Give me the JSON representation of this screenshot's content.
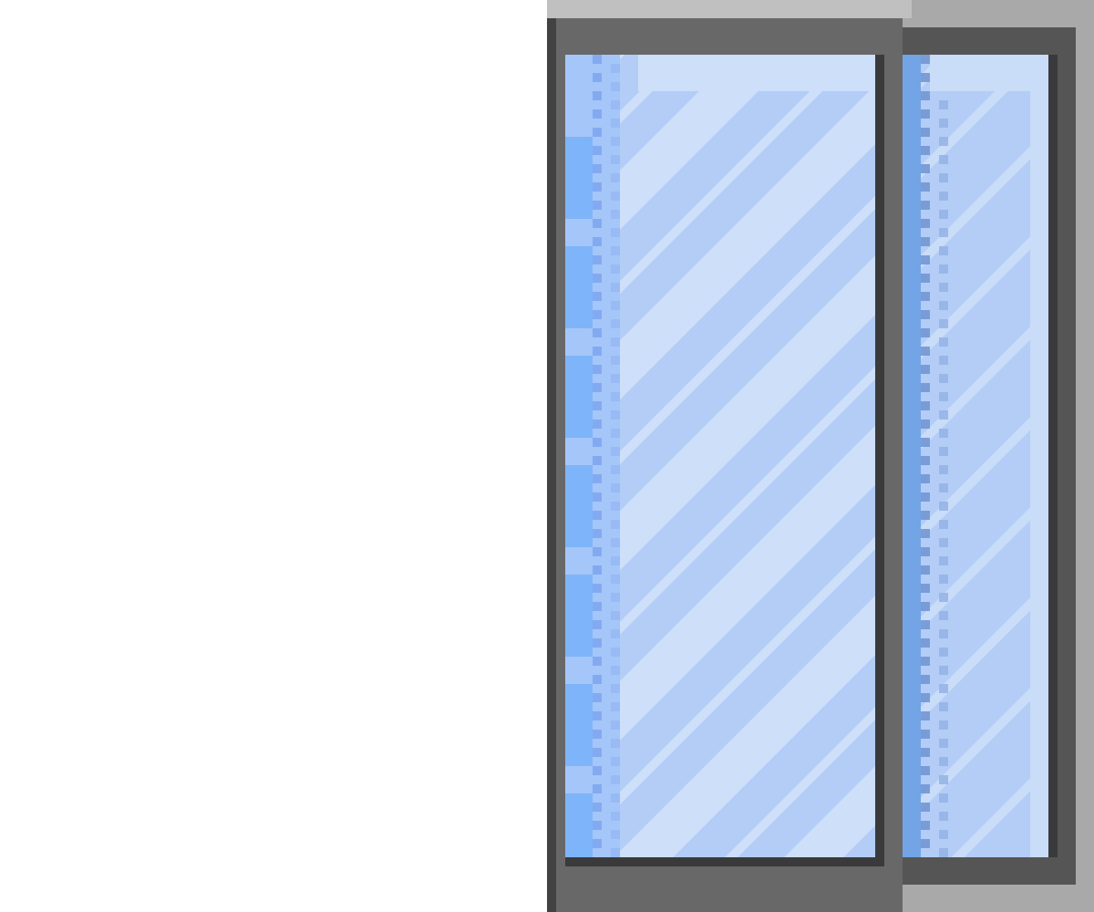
{
  "scene": {
    "description_free": true,
    "colors": {
      "wall": "#ffffff",
      "front_frame": "#686868",
      "front_frame_edge": "#424242",
      "top_rail": "#c0c0c0",
      "glass_light": "#cddff9",
      "glass_mid": "#b3cdf7",
      "glass_edge_blue": "#5fa5fa",
      "back_frame": "#555555",
      "back_outer": "#a9a9a9",
      "back_glass_edge": "#72a4e6",
      "shadow": "#3a3a3c"
    },
    "objects": [
      {
        "name": "front-door",
        "kind": "sliding-glass-panel"
      },
      {
        "name": "back-door",
        "kind": "sliding-glass-panel"
      }
    ]
  }
}
